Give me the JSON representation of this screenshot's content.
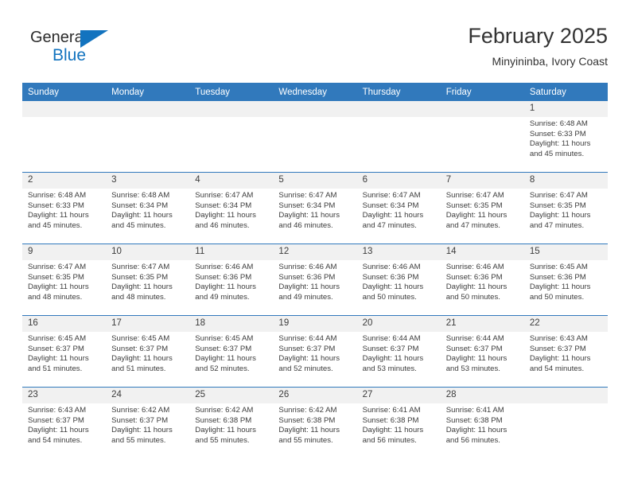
{
  "logo": {
    "word_top": "General",
    "word_bottom": "Blue",
    "triangle_color": "#1273bf",
    "text_color": "#2b2b2b"
  },
  "header": {
    "title": "February 2025",
    "subtitle": "Minyininba, Ivory Coast",
    "header_bg": "#3179bc",
    "daynum_bg": "#f1f1f1"
  },
  "weekdays": [
    "Sunday",
    "Monday",
    "Tuesday",
    "Wednesday",
    "Thursday",
    "Friday",
    "Saturday"
  ],
  "labels": {
    "sunrise": "Sunrise:",
    "sunset": "Sunset:",
    "daylight": "Daylight:"
  },
  "weeks": [
    [
      {
        "day": "",
        "blank": true
      },
      {
        "day": "",
        "blank": true
      },
      {
        "day": "",
        "blank": true
      },
      {
        "day": "",
        "blank": true
      },
      {
        "day": "",
        "blank": true
      },
      {
        "day": "",
        "blank": true
      },
      {
        "day": "1",
        "sunrise": "Sunrise: 6:48 AM",
        "sunset": "Sunset: 6:33 PM",
        "daylight": "Daylight: 11 hours and 45 minutes."
      }
    ],
    [
      {
        "day": "2",
        "sunrise": "Sunrise: 6:48 AM",
        "sunset": "Sunset: 6:33 PM",
        "daylight": "Daylight: 11 hours and 45 minutes."
      },
      {
        "day": "3",
        "sunrise": "Sunrise: 6:48 AM",
        "sunset": "Sunset: 6:34 PM",
        "daylight": "Daylight: 11 hours and 45 minutes."
      },
      {
        "day": "4",
        "sunrise": "Sunrise: 6:47 AM",
        "sunset": "Sunset: 6:34 PM",
        "daylight": "Daylight: 11 hours and 46 minutes."
      },
      {
        "day": "5",
        "sunrise": "Sunrise: 6:47 AM",
        "sunset": "Sunset: 6:34 PM",
        "daylight": "Daylight: 11 hours and 46 minutes."
      },
      {
        "day": "6",
        "sunrise": "Sunrise: 6:47 AM",
        "sunset": "Sunset: 6:34 PM",
        "daylight": "Daylight: 11 hours and 47 minutes."
      },
      {
        "day": "7",
        "sunrise": "Sunrise: 6:47 AM",
        "sunset": "Sunset: 6:35 PM",
        "daylight": "Daylight: 11 hours and 47 minutes."
      },
      {
        "day": "8",
        "sunrise": "Sunrise: 6:47 AM",
        "sunset": "Sunset: 6:35 PM",
        "daylight": "Daylight: 11 hours and 47 minutes."
      }
    ],
    [
      {
        "day": "9",
        "sunrise": "Sunrise: 6:47 AM",
        "sunset": "Sunset: 6:35 PM",
        "daylight": "Daylight: 11 hours and 48 minutes."
      },
      {
        "day": "10",
        "sunrise": "Sunrise: 6:47 AM",
        "sunset": "Sunset: 6:35 PM",
        "daylight": "Daylight: 11 hours and 48 minutes."
      },
      {
        "day": "11",
        "sunrise": "Sunrise: 6:46 AM",
        "sunset": "Sunset: 6:36 PM",
        "daylight": "Daylight: 11 hours and 49 minutes."
      },
      {
        "day": "12",
        "sunrise": "Sunrise: 6:46 AM",
        "sunset": "Sunset: 6:36 PM",
        "daylight": "Daylight: 11 hours and 49 minutes."
      },
      {
        "day": "13",
        "sunrise": "Sunrise: 6:46 AM",
        "sunset": "Sunset: 6:36 PM",
        "daylight": "Daylight: 11 hours and 50 minutes."
      },
      {
        "day": "14",
        "sunrise": "Sunrise: 6:46 AM",
        "sunset": "Sunset: 6:36 PM",
        "daylight": "Daylight: 11 hours and 50 minutes."
      },
      {
        "day": "15",
        "sunrise": "Sunrise: 6:45 AM",
        "sunset": "Sunset: 6:36 PM",
        "daylight": "Daylight: 11 hours and 50 minutes."
      }
    ],
    [
      {
        "day": "16",
        "sunrise": "Sunrise: 6:45 AM",
        "sunset": "Sunset: 6:37 PM",
        "daylight": "Daylight: 11 hours and 51 minutes."
      },
      {
        "day": "17",
        "sunrise": "Sunrise: 6:45 AM",
        "sunset": "Sunset: 6:37 PM",
        "daylight": "Daylight: 11 hours and 51 minutes."
      },
      {
        "day": "18",
        "sunrise": "Sunrise: 6:45 AM",
        "sunset": "Sunset: 6:37 PM",
        "daylight": "Daylight: 11 hours and 52 minutes."
      },
      {
        "day": "19",
        "sunrise": "Sunrise: 6:44 AM",
        "sunset": "Sunset: 6:37 PM",
        "daylight": "Daylight: 11 hours and 52 minutes."
      },
      {
        "day": "20",
        "sunrise": "Sunrise: 6:44 AM",
        "sunset": "Sunset: 6:37 PM",
        "daylight": "Daylight: 11 hours and 53 minutes."
      },
      {
        "day": "21",
        "sunrise": "Sunrise: 6:44 AM",
        "sunset": "Sunset: 6:37 PM",
        "daylight": "Daylight: 11 hours and 53 minutes."
      },
      {
        "day": "22",
        "sunrise": "Sunrise: 6:43 AM",
        "sunset": "Sunset: 6:37 PM",
        "daylight": "Daylight: 11 hours and 54 minutes."
      }
    ],
    [
      {
        "day": "23",
        "sunrise": "Sunrise: 6:43 AM",
        "sunset": "Sunset: 6:37 PM",
        "daylight": "Daylight: 11 hours and 54 minutes."
      },
      {
        "day": "24",
        "sunrise": "Sunrise: 6:42 AM",
        "sunset": "Sunset: 6:37 PM",
        "daylight": "Daylight: 11 hours and 55 minutes."
      },
      {
        "day": "25",
        "sunrise": "Sunrise: 6:42 AM",
        "sunset": "Sunset: 6:38 PM",
        "daylight": "Daylight: 11 hours and 55 minutes."
      },
      {
        "day": "26",
        "sunrise": "Sunrise: 6:42 AM",
        "sunset": "Sunset: 6:38 PM",
        "daylight": "Daylight: 11 hours and 55 minutes."
      },
      {
        "day": "27",
        "sunrise": "Sunrise: 6:41 AM",
        "sunset": "Sunset: 6:38 PM",
        "daylight": "Daylight: 11 hours and 56 minutes."
      },
      {
        "day": "28",
        "sunrise": "Sunrise: 6:41 AM",
        "sunset": "Sunset: 6:38 PM",
        "daylight": "Daylight: 11 hours and 56 minutes."
      },
      {
        "day": "",
        "blank": true
      }
    ]
  ]
}
